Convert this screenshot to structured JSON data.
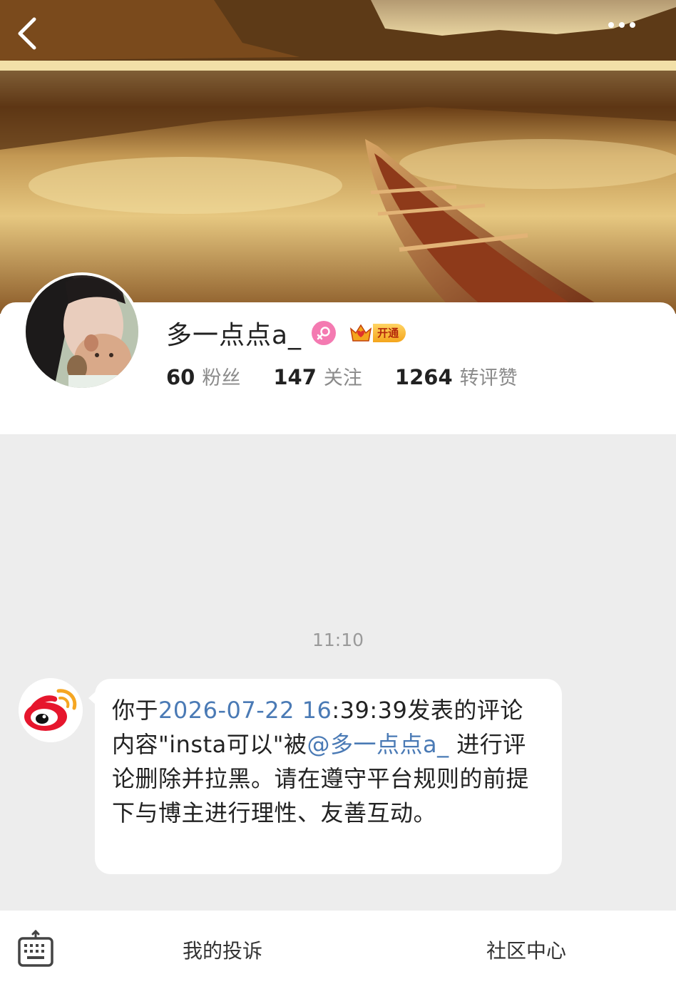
{
  "header": {
    "back_icon": "chevron-left-icon",
    "more_icon": "more-dots-icon"
  },
  "profile": {
    "name": "多一点点a_",
    "gender_icon": "female-icon",
    "vip_label": "开通",
    "stats": [
      {
        "value": "60",
        "label": "粉丝"
      },
      {
        "value": "147",
        "label": "关注"
      },
      {
        "value": "1264",
        "label": "转评赞"
      }
    ]
  },
  "chat": {
    "time": "11:10",
    "sender_icon": "weibo-logo-icon",
    "message": {
      "part1": "你于",
      "date_link": "2026-07-22 16",
      "part2": ":39:39发表的评论内容\"insta可以\"被",
      "mention": "@多一点点a_",
      "part3": " 进行评论删除并拉黑。请在遵守平台规则的前提下与博主进行理性、友善互动。"
    }
  },
  "bottom_bar": {
    "keyboard_icon": "keyboard-icon",
    "complaints_label": "我的投诉",
    "community_label": "社区中心"
  },
  "colors": {
    "link": "#4a7ab5",
    "background": "#ededed",
    "gender": "#f47ab1",
    "weibo_red": "#e6162d"
  }
}
